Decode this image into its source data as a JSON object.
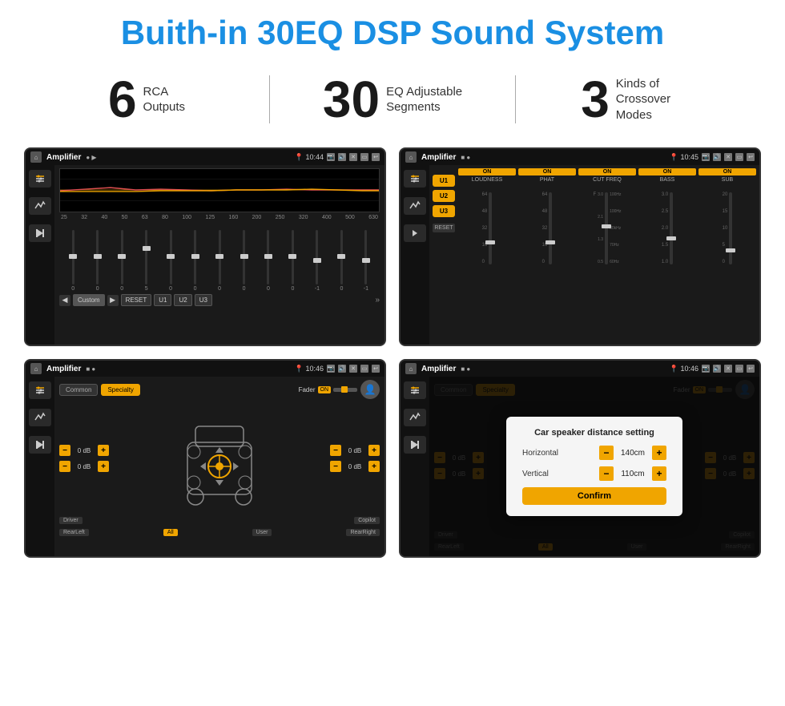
{
  "header": {
    "title": "Buith-in 30EQ DSP Sound System"
  },
  "stats": [
    {
      "number": "6",
      "text": "RCA\nOutputs"
    },
    {
      "number": "30",
      "text": "EQ Adjustable\nSegments"
    },
    {
      "number": "3",
      "text": "Kinds of\nCrossover Modes"
    }
  ],
  "screens": [
    {
      "id": "screen1",
      "status_bar": {
        "app": "Amplifier",
        "time": "10:44",
        "icons": [
          "●",
          "▶",
          "📍",
          "📷",
          "🔊",
          "✕",
          "⬜",
          "↩"
        ]
      },
      "freq_labels": [
        "25",
        "32",
        "40",
        "50",
        "63",
        "80",
        "100",
        "125",
        "160",
        "200",
        "250",
        "320",
        "400",
        "500",
        "630"
      ],
      "slider_values": [
        "0",
        "0",
        "0",
        "5",
        "0",
        "0",
        "0",
        "0",
        "0",
        "0",
        "-1",
        "0",
        "-1"
      ],
      "bottom_buttons": [
        "Custom",
        "RESET",
        "U1",
        "U2",
        "U3"
      ]
    },
    {
      "id": "screen2",
      "status_bar": {
        "app": "Amplifier",
        "time": "10:45"
      },
      "presets": [
        "U1",
        "U2",
        "U3"
      ],
      "channels": [
        {
          "label": "LOUDNESS",
          "on": true
        },
        {
          "label": "PHAT",
          "on": true
        },
        {
          "label": "CUT FREQ",
          "on": true
        },
        {
          "label": "BASS",
          "on": true
        },
        {
          "label": "SUB",
          "on": true
        }
      ]
    },
    {
      "id": "screen3",
      "status_bar": {
        "app": "Amplifier",
        "time": "10:46"
      },
      "tabs": [
        "Common",
        "Specialty"
      ],
      "fader_label": "Fader",
      "fader_on": "ON",
      "db_values": [
        "0 dB",
        "0 dB",
        "0 dB",
        "0 dB"
      ],
      "bottom_labels": [
        "Driver",
        "Copilot",
        "RearLeft",
        "All",
        "User",
        "RearRight"
      ]
    },
    {
      "id": "screen4",
      "status_bar": {
        "app": "Amplifier",
        "time": "10:46"
      },
      "dialog": {
        "title": "Car speaker distance setting",
        "horizontal_label": "Horizontal",
        "horizontal_value": "140cm",
        "vertical_label": "Vertical",
        "vertical_value": "110cm",
        "confirm_label": "Confirm"
      },
      "db_values": [
        "0 dB",
        "0 dB"
      ],
      "bottom_labels": [
        "Driver",
        "Copilot",
        "RearLeft",
        "All",
        "User",
        "RearRight"
      ]
    }
  ]
}
